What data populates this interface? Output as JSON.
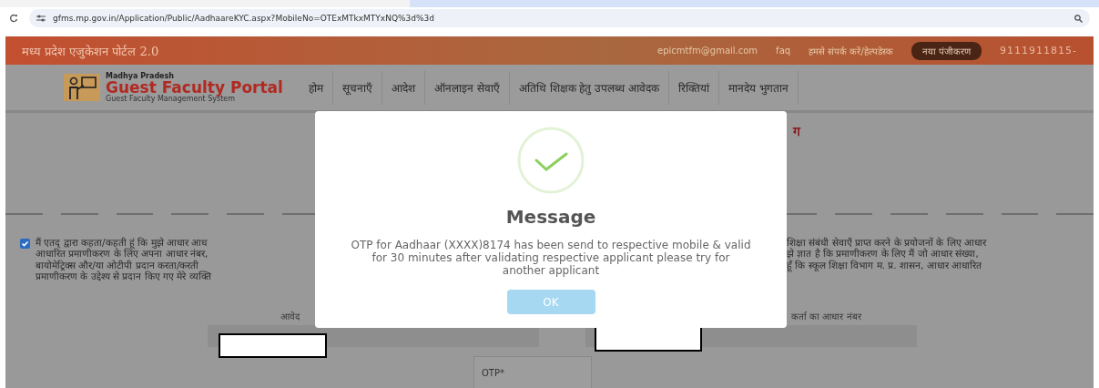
{
  "browser": {
    "url": "gfms.mp.gov.in/Application/Public/AadhaareKYC.aspx?MobileNo=OTExMTkxMTYxNQ%3d%3d"
  },
  "top_bar": {
    "title": "मध्य प्रदेश एजुकेशन पोर्टल 2.0",
    "email": "epicmtfm@gmail.com",
    "faq": "faq",
    "contact": "हमसे संपर्क करें/हेल्पडेस्क",
    "register_button": "नया पंजीकरण",
    "phone": "9111911815-"
  },
  "logo": {
    "state": "Madhya Pradesh",
    "title": "Guest Faculty Portal",
    "subtitle": "Guest Faculty Management System"
  },
  "nav": [
    "होम",
    "सूचनाएँ",
    "आदेश",
    "ऑनलाइन सेवाएँ",
    "अतिथि शिक्षक हेतु उपलब्ध आवेदक",
    "रिक्तियां",
    "मानदेय भुगतान"
  ],
  "page_heading": "ग",
  "consent": {
    "checked": true,
    "left_lines": [
      "मैं एतद् द्वारा कहता/कहती हूं कि मुझे आधार आध",
      "आधारित प्रमाणीकरण के लिए अपना आधार नंबर,",
      "बायोमेट्रिक्स और/या ओटीपी प्रदान करता/करती",
      "प्रमाणीकरण के उद्देश्य से प्रदान किए गए मेरे व्यक्ति"
    ],
    "right_lines": [
      "शिक्षा संबंधी सेवाएँ प्राप्त करने के प्रयोजनों के लिए आधार",
      "झे ज्ञात है कि प्रमाणीकरण के लिए मैं जो आधार संख्या,",
      "हूँ कि स्कूल शिक्षा विभाग म. प्र. शासन, आधार आधारित"
    ]
  },
  "fields": [
    {
      "label": "आवेद"
    },
    {
      "label": "कर्ता का आधार नंबर"
    }
  ],
  "otp": {
    "label": "OTP*"
  },
  "dialog": {
    "title": "Message",
    "text": "OTP for Aadhaar (XXXX)8174 has been send to respective mobile & valid for 30 minutes after validating respective applicant please try for another applicant",
    "button": "OK"
  }
}
